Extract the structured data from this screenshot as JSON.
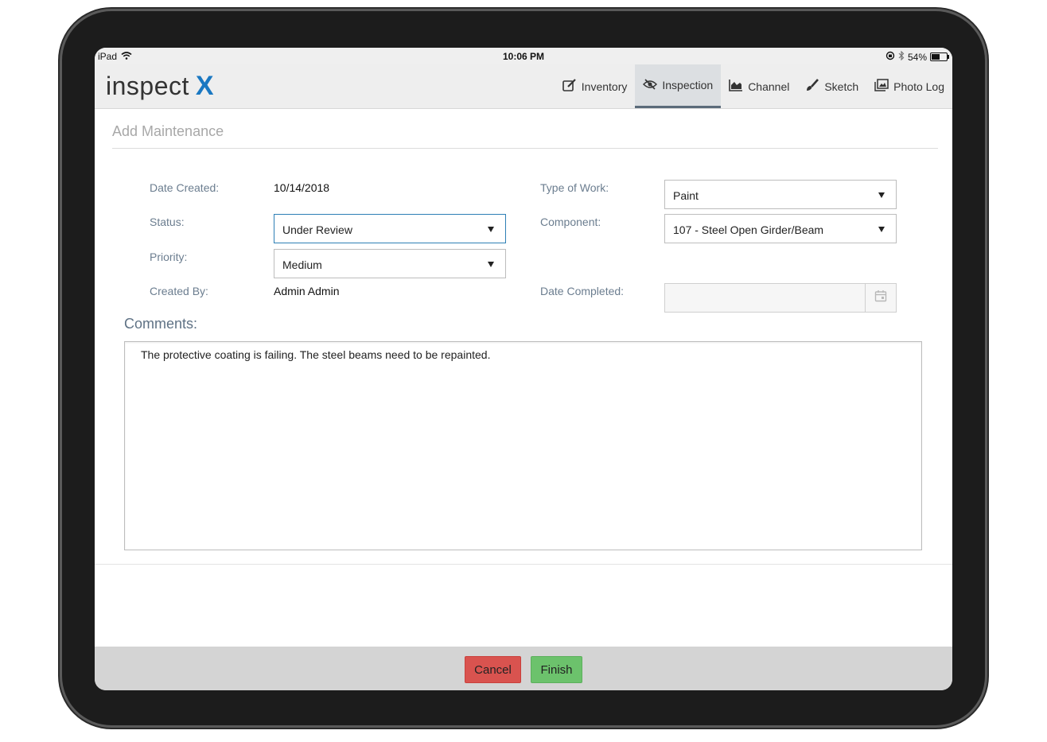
{
  "statusbar": {
    "device": "iPad",
    "time": "10:06 PM",
    "battery": "54%",
    "battery_level": 0.54
  },
  "navbar": {
    "logo_text": "inspect",
    "logo_mark": "X",
    "tabs": [
      {
        "label": "Inventory",
        "icon": "edit-icon"
      },
      {
        "label": "Inspection",
        "icon": "eye-slash-icon",
        "active": true
      },
      {
        "label": "Channel",
        "icon": "area-chart-icon"
      },
      {
        "label": "Sketch",
        "icon": "paintbrush-icon"
      },
      {
        "label": "Photo Log",
        "icon": "images-icon"
      }
    ]
  },
  "page": {
    "title": "Add Maintenance"
  },
  "form": {
    "date_created_label": "Date Created:",
    "date_created_value": "10/14/2018",
    "status_label": "Status:",
    "status_value": "Under Review",
    "priority_label": "Priority:",
    "priority_value": "Medium",
    "created_by_label": "Created By:",
    "created_by_value": "Admin Admin",
    "type_of_work_label": "Type of Work:",
    "type_of_work_value": "Paint",
    "component_label": "Component:",
    "component_value": "107 - Steel Open Girder/Beam",
    "date_completed_label": "Date Completed:",
    "date_completed_value": "",
    "comments_label": "Comments:",
    "comments_value": "The protective coating is failing. The steel beams need to be repainted."
  },
  "footer": {
    "cancel_label": "Cancel",
    "finish_label": "Finish"
  },
  "colors": {
    "accent": "#1a78c2",
    "cancel": "#d9534f",
    "finish": "#6cc26c",
    "label": "#6b7d8f",
    "focus_border": "#2d7fb5"
  }
}
